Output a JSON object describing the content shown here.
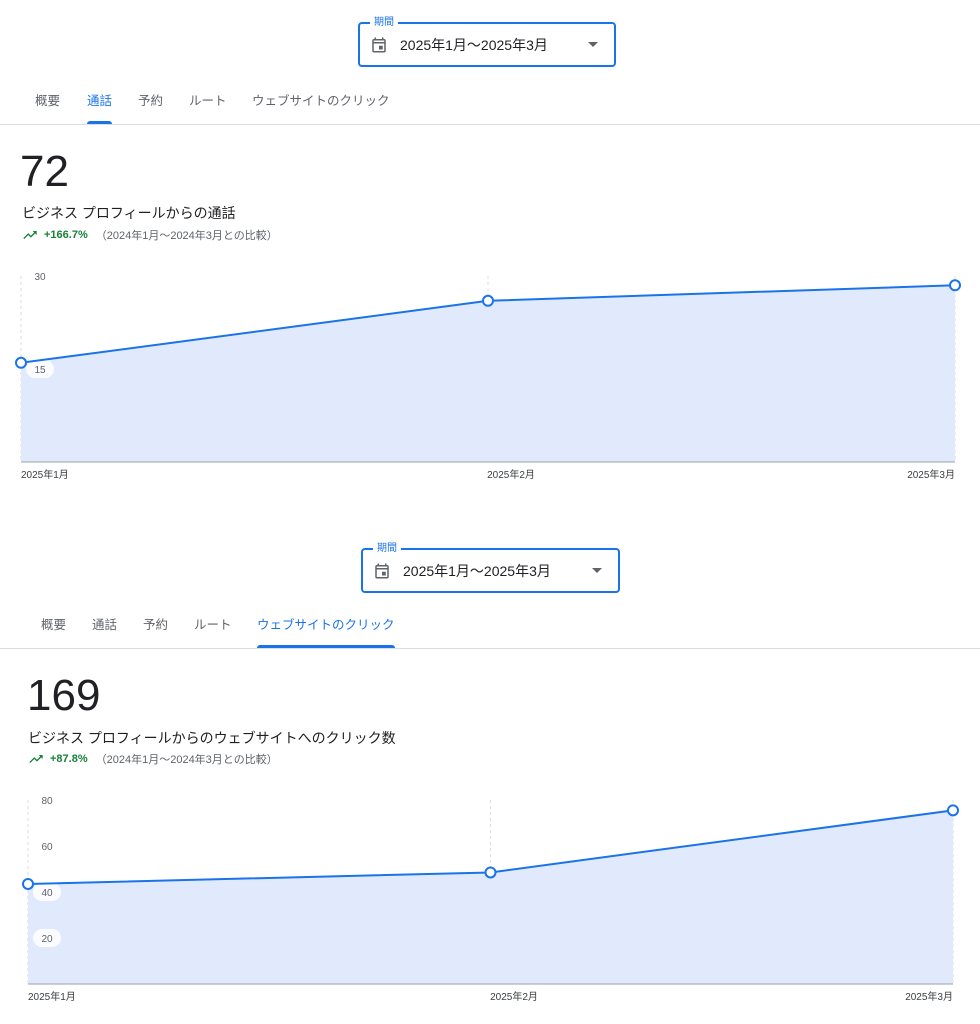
{
  "panels": [
    {
      "period": {
        "legend": "期間",
        "value": "2025年1月〜2025年3月"
      },
      "tabs": [
        {
          "label": "概要",
          "active": false
        },
        {
          "label": "通話",
          "active": true
        },
        {
          "label": "予約",
          "active": false
        },
        {
          "label": "ルート",
          "active": false
        },
        {
          "label": "ウェブサイトのクリック",
          "active": false
        }
      ],
      "metric": {
        "value": "72",
        "label": "ビジネス プロフィールからの通話",
        "change": "+166.7%",
        "comparison": "（2024年1月〜2024年3月との比較）"
      }
    },
    {
      "period": {
        "legend": "期間",
        "value": "2025年1月〜2025年3月"
      },
      "tabs": [
        {
          "label": "概要",
          "active": false
        },
        {
          "label": "通話",
          "active": false
        },
        {
          "label": "予約",
          "active": false
        },
        {
          "label": "ルート",
          "active": false
        },
        {
          "label": "ウェブサイトのクリック",
          "active": true
        }
      ],
      "metric": {
        "value": "169",
        "label": "ビジネス プロフィールからのウェブサイトへのクリック数",
        "change": "+87.8%",
        "comparison": "（2024年1月〜2024年3月との比較）"
      }
    }
  ],
  "colors": {
    "accent": "#1a73e8",
    "positive": "#188038",
    "area_fill": "#e1eafc"
  },
  "icons": {
    "period": "calendar-icon",
    "dropdown": "arrow-drop-down-icon",
    "trend": "trending-up-icon"
  },
  "chart_data": [
    {
      "type": "area",
      "title": "",
      "x": [
        "2025年1月",
        "2025年2月",
        "2025年3月"
      ],
      "series": [
        {
          "values": [
            16,
            26,
            28.5
          ]
        }
      ],
      "ylim": [
        0,
        30
      ],
      "yticks": [
        15,
        30
      ],
      "grid": "vertical dashed"
    },
    {
      "type": "area",
      "title": "",
      "x": [
        "2025年1月",
        "2025年2月",
        "2025年3月"
      ],
      "series": [
        {
          "values": [
            43.5,
            48.5,
            75.5
          ]
        }
      ],
      "ylim": [
        0,
        80
      ],
      "yticks": [
        20,
        40,
        60,
        80
      ],
      "grid": "vertical dashed"
    }
  ]
}
